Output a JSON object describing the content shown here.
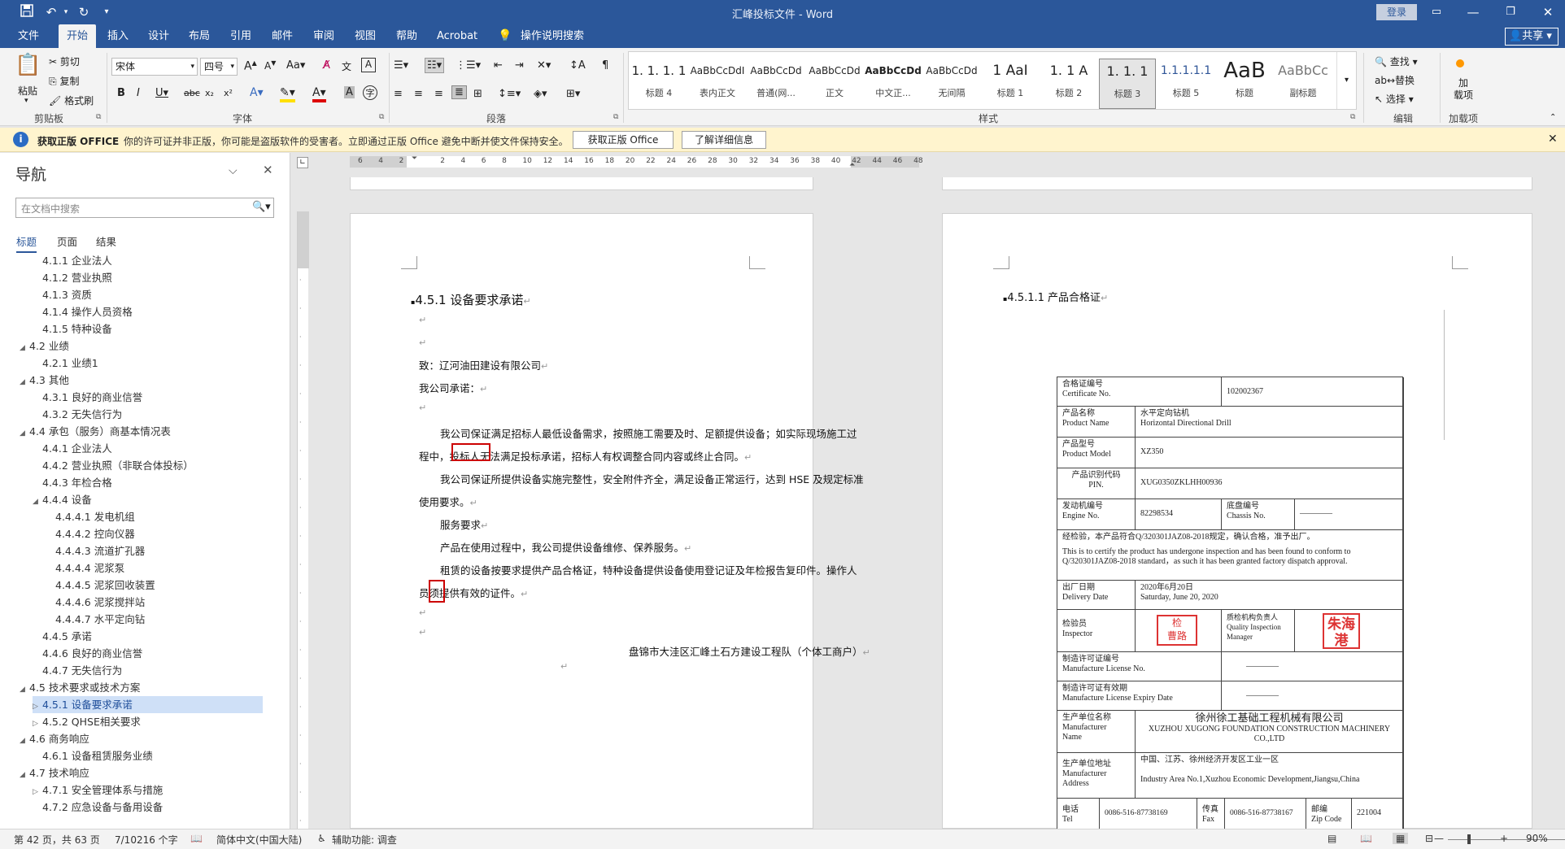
{
  "titlebar": {
    "title": "汇峰投标文件  -  Word",
    "login": "登录"
  },
  "tabs": [
    {
      "label": "文件"
    },
    {
      "label": "开始"
    },
    {
      "label": "插入"
    },
    {
      "label": "设计"
    },
    {
      "label": "布局"
    },
    {
      "label": "引用"
    },
    {
      "label": "邮件"
    },
    {
      "label": "审阅"
    },
    {
      "label": "视图"
    },
    {
      "label": "帮助"
    },
    {
      "label": "Acrobat"
    },
    {
      "label": "操作说明搜索"
    }
  ],
  "share": "共享",
  "clipboard": {
    "paste": "粘贴",
    "cut": "剪切",
    "copy": "复制",
    "format_painter": "格式刷",
    "group": "剪贴板"
  },
  "font": {
    "name": "宋体",
    "size": "四号",
    "group": "字体"
  },
  "paragraph": {
    "group": "段落"
  },
  "styles": {
    "group": "样式",
    "items": [
      {
        "preview": "1. 1. 1. 1",
        "name": "标题 4"
      },
      {
        "preview": "AaBbCcDdI",
        "name": "表内正文"
      },
      {
        "preview": "AaBbCcDd",
        "name": "普通(网..."
      },
      {
        "preview": "AaBbCcDd",
        "name": "正文"
      },
      {
        "preview": "AaBbCcDd",
        "name": "中文正..."
      },
      {
        "preview": "AaBbCcDd",
        "name": "无间隔"
      },
      {
        "preview": "1  AaI",
        "name": "标题 1"
      },
      {
        "preview": "1. 1  A",
        "name": "标题 2"
      },
      {
        "preview": "1. 1. 1",
        "name": "标题 3"
      },
      {
        "preview": "1.1.1.1.1",
        "name": "标题 5"
      },
      {
        "preview": "AaB",
        "name": "标题"
      },
      {
        "preview": "AaBbCc",
        "name": "副标题"
      }
    ]
  },
  "editing": {
    "find": "查找",
    "replace": "替换",
    "select": "选择",
    "group": "编辑"
  },
  "addins": {
    "label": "加\n载项",
    "group": "加载项"
  },
  "infobar": {
    "title": "获取正版 OFFICE",
    "message": "你的许可证并非正版，你可能是盗版软件的受害者。立即通过正版 Office 避免中断并使文件保持安全。",
    "btn1": "获取正版 Office",
    "btn2": "了解详细信息"
  },
  "ruler": {
    "ticks": [
      "6",
      "4",
      "2",
      "",
      "2",
      "4",
      "6",
      "8",
      "10",
      "12",
      "14",
      "16",
      "18",
      "20",
      "22",
      "24",
      "26",
      "28",
      "30",
      "32",
      "34",
      "36",
      "38",
      "40",
      "42",
      "44",
      "46",
      "48"
    ]
  },
  "nav": {
    "title": "导航",
    "search_placeholder": "在文档中搜索",
    "tabs": [
      "标题",
      "页面",
      "结果"
    ],
    "items": [
      {
        "text": "4.1.1 企业法人",
        "level": 3,
        "tri": ""
      },
      {
        "text": "4.1.2 营业执照",
        "level": 3,
        "tri": ""
      },
      {
        "text": "4.1.3 资质",
        "level": 3,
        "tri": ""
      },
      {
        "text": "4.1.4 操作人员资格",
        "level": 3,
        "tri": ""
      },
      {
        "text": "4.1.5 特种设备",
        "level": 3,
        "tri": ""
      },
      {
        "text": "4.2 业绩",
        "level": 2,
        "tri": "◢"
      },
      {
        "text": "4.2.1 业绩1",
        "level": 3,
        "tri": ""
      },
      {
        "text": "4.3 其他",
        "level": 2,
        "tri": "◢"
      },
      {
        "text": "4.3.1 良好的商业信誉",
        "level": 3,
        "tri": ""
      },
      {
        "text": "4.3.2 无失信行为",
        "level": 3,
        "tri": ""
      },
      {
        "text": "4.4 承包（服务）商基本情况表",
        "level": 2,
        "tri": "◢"
      },
      {
        "text": "4.4.1 企业法人",
        "level": 3,
        "tri": ""
      },
      {
        "text": "4.4.2 营业执照（非联合体投标）",
        "level": 3,
        "tri": ""
      },
      {
        "text": "4.4.3 年检合格",
        "level": 3,
        "tri": ""
      },
      {
        "text": "4.4.4 设备",
        "level": 3,
        "tri": "◢"
      },
      {
        "text": "4.4.4.1 发电机组",
        "level": 4,
        "tri": ""
      },
      {
        "text": "4.4.4.2 控向仪器",
        "level": 4,
        "tri": ""
      },
      {
        "text": "4.4.4.3 流道扩孔器",
        "level": 4,
        "tri": ""
      },
      {
        "text": "4.4.4.4 泥浆泵",
        "level": 4,
        "tri": ""
      },
      {
        "text": "4.4.4.5 泥浆回收装置",
        "level": 4,
        "tri": ""
      },
      {
        "text": "4.4.4.6 泥浆搅拌站",
        "level": 4,
        "tri": ""
      },
      {
        "text": "4.4.4.7 水平定向钻",
        "level": 4,
        "tri": ""
      },
      {
        "text": "4.4.5 承诺",
        "level": 3,
        "tri": ""
      },
      {
        "text": "4.4.6 良好的商业信誉",
        "level": 3,
        "tri": ""
      },
      {
        "text": "4.4.7 无失信行为",
        "level": 3,
        "tri": ""
      },
      {
        "text": "4.5 技术要求或技术方案",
        "level": 2,
        "tri": "◢"
      },
      {
        "text": "4.5.1 设备要求承诺",
        "level": 3,
        "tri": "▷",
        "selected": true
      },
      {
        "text": "4.5.2 QHSE相关要求",
        "level": 3,
        "tri": "▷"
      },
      {
        "text": "4.6 商务响应",
        "level": 2,
        "tri": "◢"
      },
      {
        "text": "4.6.1 设备租赁服务业绩",
        "level": 3,
        "tri": ""
      },
      {
        "text": "4.7 技术响应",
        "level": 2,
        "tri": "◢"
      },
      {
        "text": "4.7.1 安全管理体系与措施",
        "level": 3,
        "tri": "▷"
      },
      {
        "text": "4.7.2 应急设备与备用设备",
        "level": 3,
        "tri": ""
      }
    ]
  },
  "page1": {
    "heading": "4.5.1  设备要求承诺",
    "to": "致：辽河油田建设有限公司",
    "promise": "我公司承诺：",
    "p1a": "我公司保证满足招标人最低设备需求，按照施工需要及时、足额提供设备；如实际现场施工过",
    "p1b": "程中，投标人无法满足投标承诺，招标人有权调整合同内容或终止合同。",
    "p2a": "我公司保证所提供设备实施完整性，安全附件齐全，满足设备正常运行，达到 HSE 及规定标准",
    "p2b": "使用要求。",
    "p3": "服务要求",
    "p4": "产品在使用过程中，我公司提供设备维修、保养服务。",
    "p5a": "租赁的设备按要求提供产品合格证，特种设备提供设备使用登记证及年检报告复印件。操作人",
    "p5b": "员须提供有效的证件。",
    "signature": "盘锦市大洼区汇峰土石方建设工程队（个体工商户）"
  },
  "page2": {
    "heading": "4.5.1.1      产品合格证",
    "cert": {
      "cert_no_label": "合格证编号\nCertificate No.",
      "cert_no": "102002367",
      "product_name_label": "产品名称\nProduct Name",
      "product_name": "水平定向钻机\nHorizontal Directional Drill",
      "model_label": "产品型号\nProduct Model",
      "model": "XZ350",
      "pin_label": "产品识别代码\nPIN.",
      "pin": "XUG0350ZKLHH00936",
      "engine_label": "发动机编号\nEngine No.",
      "engine": "82298534",
      "chassis_label": "底盘编号\nChassis No.",
      "chassis": "————",
      "inspect_cn": "经检验，本产品符合Q/320301JAZ08-2018规定，确认合格，准予出厂。",
      "inspect_en": "This is to certify the product has undergone inspection and has been found to conform to Q/320301JAZ08-2018  standard，as such it has been granted factory dispatch approval.",
      "delivery_label": "出厂日期\nDelivery Date",
      "delivery": "2020年6月20日\nSaturday, June 20, 2020",
      "inspector_label": "检验员\nInspector",
      "inspector_stamp": "检\n曹路",
      "qi_label": "质检机构负责人\nQuality Inspection\nManager",
      "qi_stamp": "朱海港",
      "license_label": "制造许可证编号\nManufacture License No.",
      "license": "————",
      "expiry_label": "制造许可证有效期\nManufacture License Expiry Date",
      "expiry": "————",
      "manu_label": "生产单位名称\nManufacturer\nName",
      "manu_cn": "徐州徐工基础工程机械有限公司",
      "manu_en": "XUZHOU XUGONG FOUNDATION CONSTRUCTION MACHINERY CO.,LTD",
      "addr_label": "生产单位地址\nManufacturer\nAddress",
      "addr_cn": "中国、江苏、徐州经济开发区工业一区",
      "addr_en": "Industry Area No.1,Xuzhou Economic Development,Jiangsu,China",
      "tel_label": "电话\nTel",
      "tel": "0086-516-87738169",
      "fax_label": "传真\nFax",
      "fax": "0086-516-87738167",
      "zip_label": "邮编\nZip Code",
      "zip": "221004"
    }
  },
  "status": {
    "page": "第 42 页，共 63 页",
    "words": "7/10216 个字",
    "lang": "简体中文(中国大陆)",
    "access": "辅助功能: 调查",
    "zoom": "90%"
  }
}
